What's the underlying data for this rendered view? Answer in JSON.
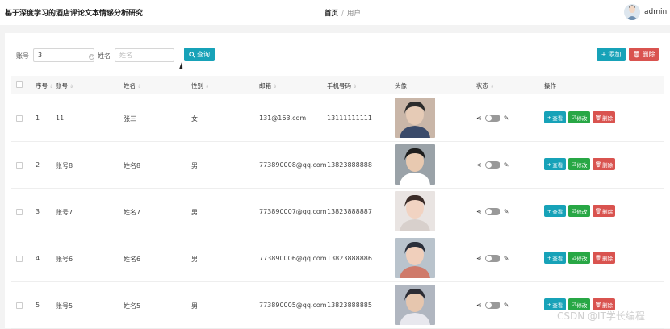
{
  "header": {
    "app_title": "基于深度学习的酒店评论文本情感分析研究",
    "breadcrumb_home": "首页",
    "breadcrumb_sep": "/",
    "breadcrumb_current": "用户",
    "user_name": "admin"
  },
  "search": {
    "account_label": "账号",
    "account_value": "3",
    "name_label": "姓名",
    "name_placeholder": "姓名",
    "search_button": "查询",
    "add_button": "添加",
    "delete_button": "删除"
  },
  "table": {
    "columns": [
      "序号",
      "账号",
      "姓名",
      "性别",
      "邮箱",
      "手机号码",
      "头像",
      "状态",
      "操作"
    ],
    "rows": [
      {
        "index": "1",
        "account": "11",
        "name": "张三",
        "gender": "女",
        "email": "131@163.com",
        "phone": "13111111111"
      },
      {
        "index": "2",
        "account": "账号8",
        "name": "姓名8",
        "gender": "男",
        "email": "773890008@qq.com",
        "phone": "13823888888"
      },
      {
        "index": "3",
        "account": "账号7",
        "name": "姓名7",
        "gender": "男",
        "email": "773890007@qq.com",
        "phone": "13823888887"
      },
      {
        "index": "4",
        "account": "账号6",
        "name": "姓名6",
        "gender": "男",
        "email": "773890006@qq.com",
        "phone": "13823888886"
      },
      {
        "index": "5",
        "account": "账号5",
        "name": "姓名5",
        "gender": "男",
        "email": "773890005@qq.com",
        "phone": "13823888885"
      }
    ],
    "actions": {
      "view": "查看",
      "edit": "修改",
      "delete": "删除"
    }
  },
  "watermark": "CSDN @IT学长编程",
  "colors": {
    "primary": "#17a2b8",
    "success": "#28a745",
    "danger": "#d9534f"
  }
}
